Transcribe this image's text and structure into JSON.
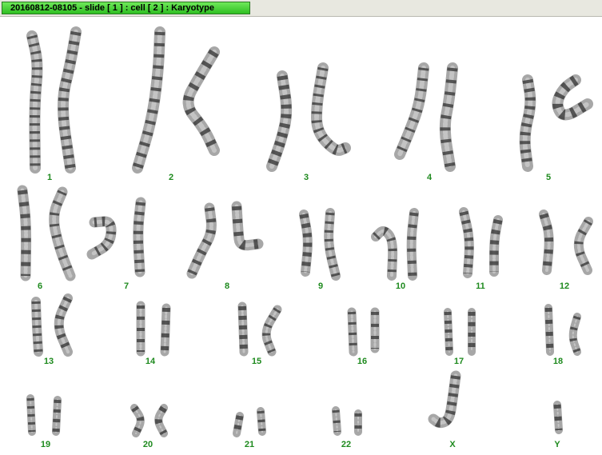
{
  "window": {
    "title": "20160812-08105 - slide [ 1 ] : cell [ 2 ] : Karyotype"
  },
  "karyotype": {
    "chromosomes": [
      {
        "label": "1"
      },
      {
        "label": "2"
      },
      {
        "label": "3"
      },
      {
        "label": "4"
      },
      {
        "label": "5"
      },
      {
        "label": "6"
      },
      {
        "label": "7"
      },
      {
        "label": "8"
      },
      {
        "label": "9"
      },
      {
        "label": "10"
      },
      {
        "label": "11"
      },
      {
        "label": "12"
      },
      {
        "label": "13"
      },
      {
        "label": "14"
      },
      {
        "label": "15"
      },
      {
        "label": "16"
      },
      {
        "label": "17"
      },
      {
        "label": "18"
      },
      {
        "label": "19"
      },
      {
        "label": "20"
      },
      {
        "label": "21"
      },
      {
        "label": "22"
      },
      {
        "label": "X"
      },
      {
        "label": "Y"
      }
    ],
    "colors": {
      "label": "#1e8a1e",
      "chromosome": "#8a8a8a",
      "band": "#3a3a3a"
    }
  }
}
